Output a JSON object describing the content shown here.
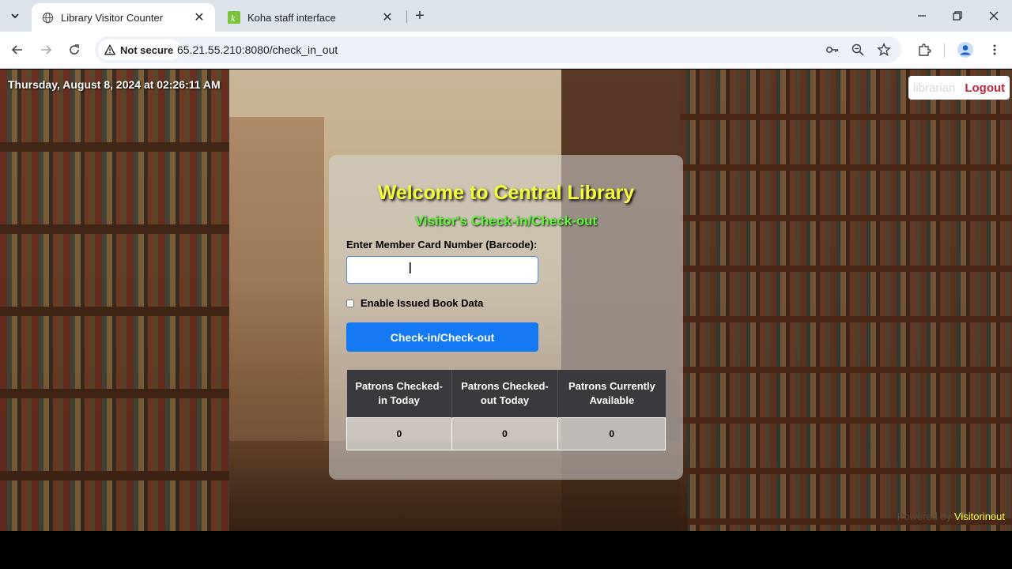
{
  "browser": {
    "tabs": [
      {
        "title": "Library Visitor Counter",
        "active": true
      },
      {
        "title": "Koha staff interface",
        "active": false
      }
    ],
    "security_label": "Not secure",
    "url": "65.21.55.210:8080/check_in_out",
    "icons": [
      "tab-search-icon",
      "back-icon",
      "forward-icon",
      "reload-icon",
      "key-icon",
      "zoom-icon",
      "star-icon",
      "extensions-icon",
      "profile-icon",
      "menu-icon"
    ]
  },
  "header": {
    "datetime": "Thursday, August 8, 2024 at 02:26:11 AM",
    "username": "librarian",
    "logout_label": "Logout"
  },
  "card": {
    "title": "Welcome to Central Library",
    "subtitle": "Visitor's Check-in/Check-out",
    "barcode_label": "Enter Member Card Number (Barcode):",
    "barcode_value": "",
    "issued_checkbox_label": "Enable Issued Book Data",
    "issued_checked": false,
    "submit_label": "Check-in/Check-out"
  },
  "stats": {
    "headers": [
      "Patrons Checked-in Today",
      "Patrons Checked-out Today",
      "Patrons Currently Available"
    ],
    "values": [
      "0",
      "0",
      "0"
    ]
  },
  "footer": {
    "powered_prefix": "Powered by",
    "brand": "Visitorinout"
  },
  "colors": {
    "title": "#f4ff3a",
    "subtitle": "#5ef53a",
    "button": "#1479f2",
    "logout": "#c0253a",
    "table_header": "#383a3e"
  }
}
